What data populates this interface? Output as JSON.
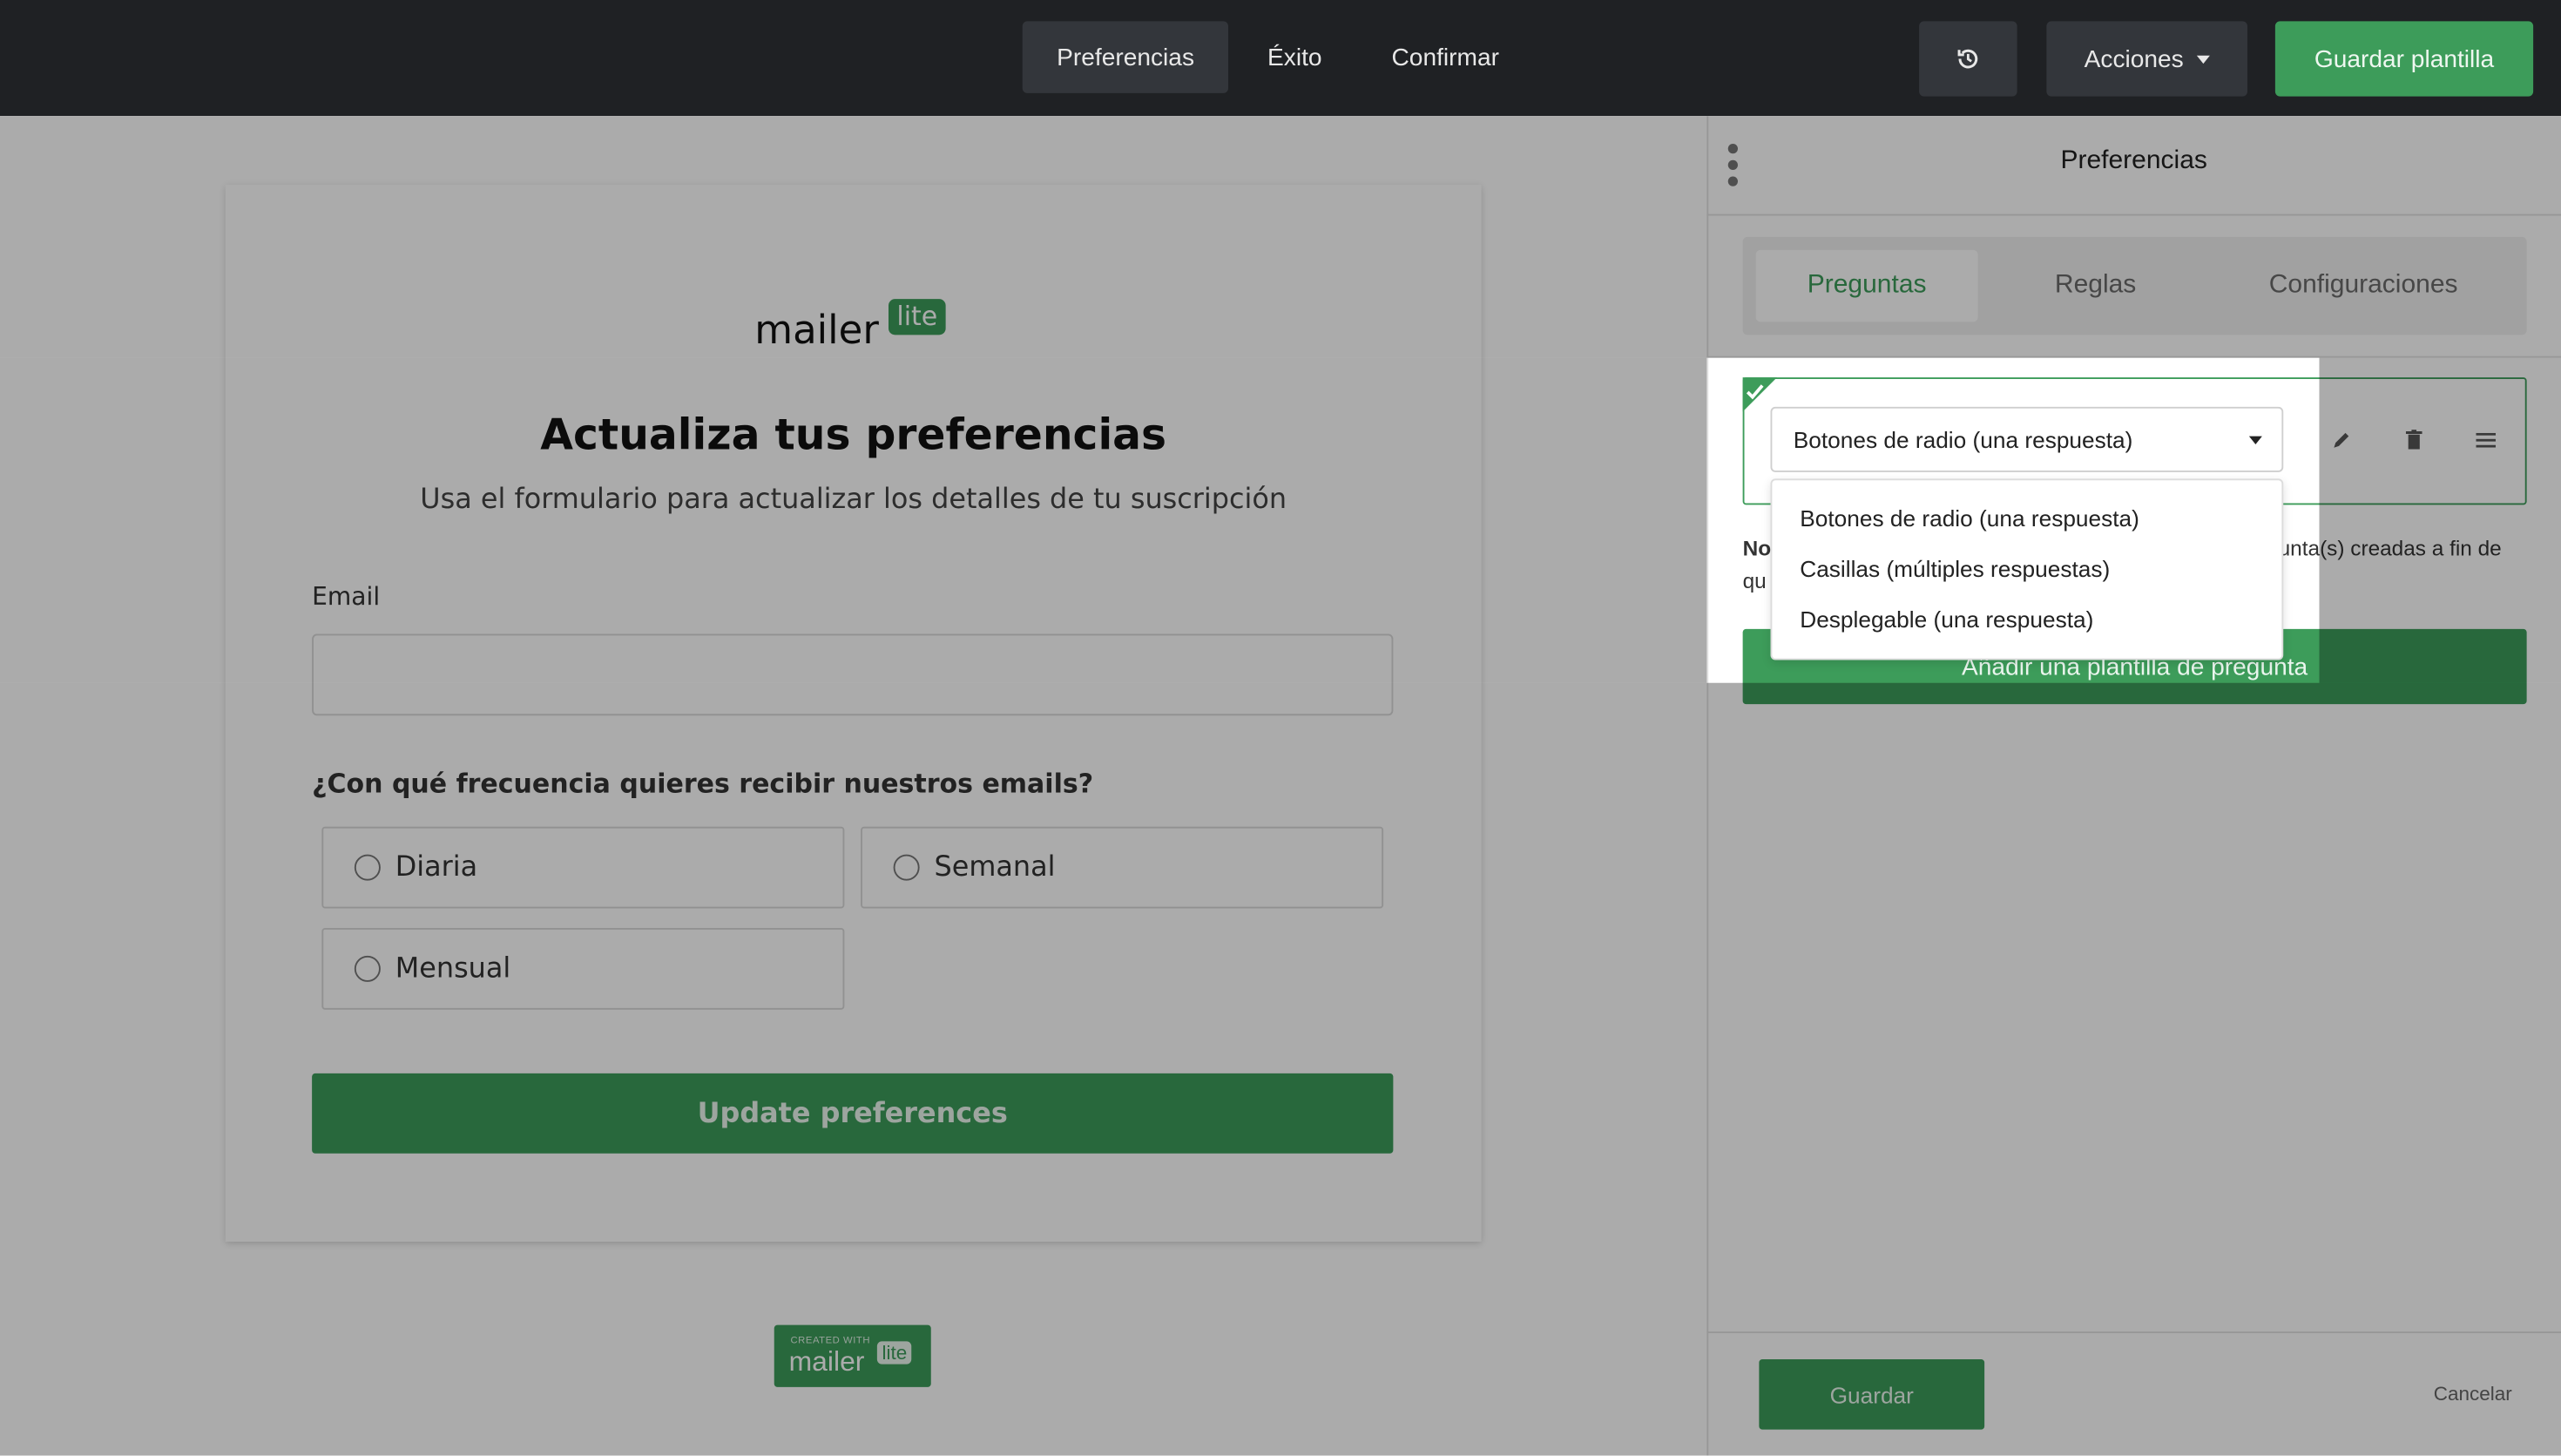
{
  "topbar": {
    "tabs": [
      {
        "label": "Preferencias",
        "active": true
      },
      {
        "label": "Éxito",
        "active": false
      },
      {
        "label": "Confirmar",
        "active": false
      }
    ],
    "history_icon": "history-icon",
    "actions_label": "Acciones",
    "save_template_label": "Guardar plantilla"
  },
  "form": {
    "logo_text": "mailer",
    "logo_badge": "lite",
    "title": "Actualiza tus preferencias",
    "subtitle": "Usa el formulario para actualizar los detalles de tu suscripción",
    "email_label": "Email",
    "email_value": "",
    "question": "¿Con qué frecuencia quieres recibir nuestros emails?",
    "options": [
      "Diaria",
      "Semanal",
      "Mensual"
    ],
    "submit_label": "Update preferences",
    "footer_badge_top": "CREATED WITH",
    "footer_badge_word": "mailer",
    "footer_badge_lite": "lite"
  },
  "panel": {
    "title": "Preferencias",
    "tabs": [
      {
        "label": "Preguntas",
        "active": true
      },
      {
        "label": "Reglas",
        "active": false
      },
      {
        "label": "Configuraciones",
        "active": false
      }
    ],
    "question_type_selected": "Botones de radio (una respuesta)",
    "question_type_options": [
      "Botones de radio (una respuesta)",
      "Casillas (múltiples respuestas)",
      "Desplegable (una respuesta)"
    ],
    "note_bold": "No",
    "note_line1_tail": "unta(s) creadas a fin de",
    "note_line2_start": "qu",
    "add_question_label": "Añadir una plantilla de pregunta",
    "save_label": "Guardar",
    "cancel_label": "Cancelar"
  },
  "colors": {
    "brand_green": "#3d9c5a",
    "topbar_bg": "#1f2124",
    "overlay": "rgba(0,0,0,0.33)"
  }
}
